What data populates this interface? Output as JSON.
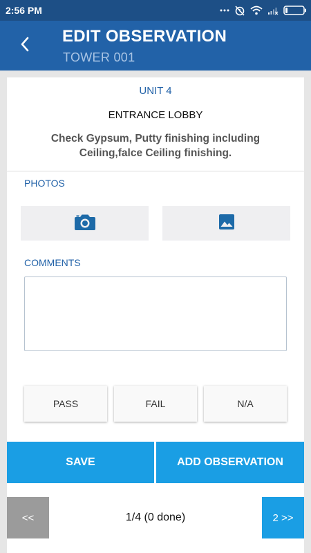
{
  "status_bar": {
    "time": "2:56 PM",
    "icons": [
      "more-dots-icon",
      "alarm-off-icon",
      "wifi-icon",
      "cellular-signal-icon",
      "battery-icon"
    ]
  },
  "header": {
    "title": "EDIT OBSERVATION",
    "subtitle": "TOWER 001",
    "back_icon": "chevron-left-icon"
  },
  "observation": {
    "unit": "UNIT 4",
    "location": "ENTRANCE LOBBY",
    "check_text": "Check Gypsum, Putty finishing including Ceiling,falce Ceiling finishing."
  },
  "photos": {
    "label": "PHOTOS",
    "camera_icon": "camera-icon",
    "gallery_icon": "image-icon"
  },
  "comments": {
    "label": "COMMENTS",
    "value": "",
    "placeholder": ""
  },
  "choices": {
    "pass": "PASS",
    "fail": "FAIL",
    "na": "N/A"
  },
  "actions": {
    "save": "SAVE",
    "add_observation": "ADD OBSERVATION"
  },
  "pager": {
    "prev_label": "<<",
    "status": "1/4 (0 done)",
    "next_label": "2 >>"
  },
  "colors": {
    "header": "#2262a8",
    "status_bar": "#1d4f86",
    "accent": "#1a9ee4",
    "label_blue": "#2262a8"
  }
}
